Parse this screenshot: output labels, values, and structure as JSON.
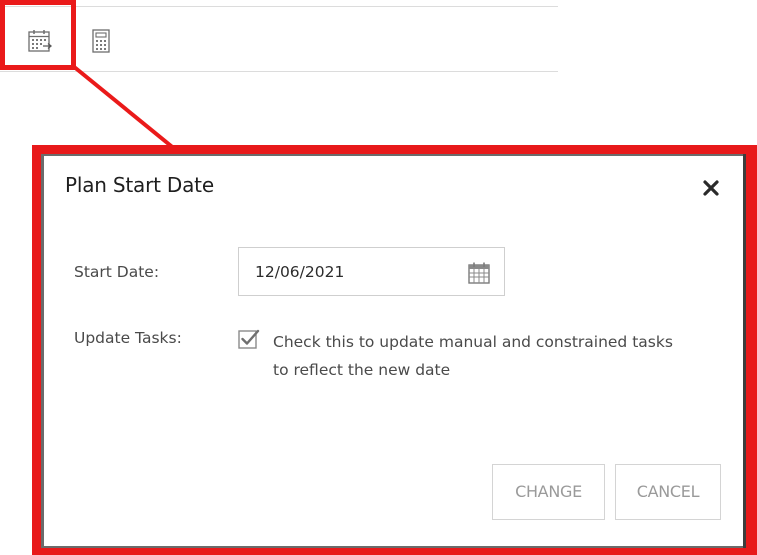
{
  "toolbar": {
    "icons": [
      "calendar-date-icon",
      "calculator-icon"
    ]
  },
  "dialog": {
    "title": "Plan Start Date",
    "close_icon": "close-icon",
    "start_date_label": "Start Date:",
    "start_date_value": "12/06/2021",
    "update_tasks_label": "Update Tasks:",
    "update_tasks_checked": true,
    "update_tasks_line1": "Check this to update manual and constrained tasks",
    "update_tasks_line2": "to reflect the new date",
    "change_label": "CHANGE",
    "cancel_label": "CANCEL"
  },
  "colors": {
    "highlight": "#ea1a1a",
    "button_text": "#9a9a9a",
    "border": "#d4d4d4"
  }
}
